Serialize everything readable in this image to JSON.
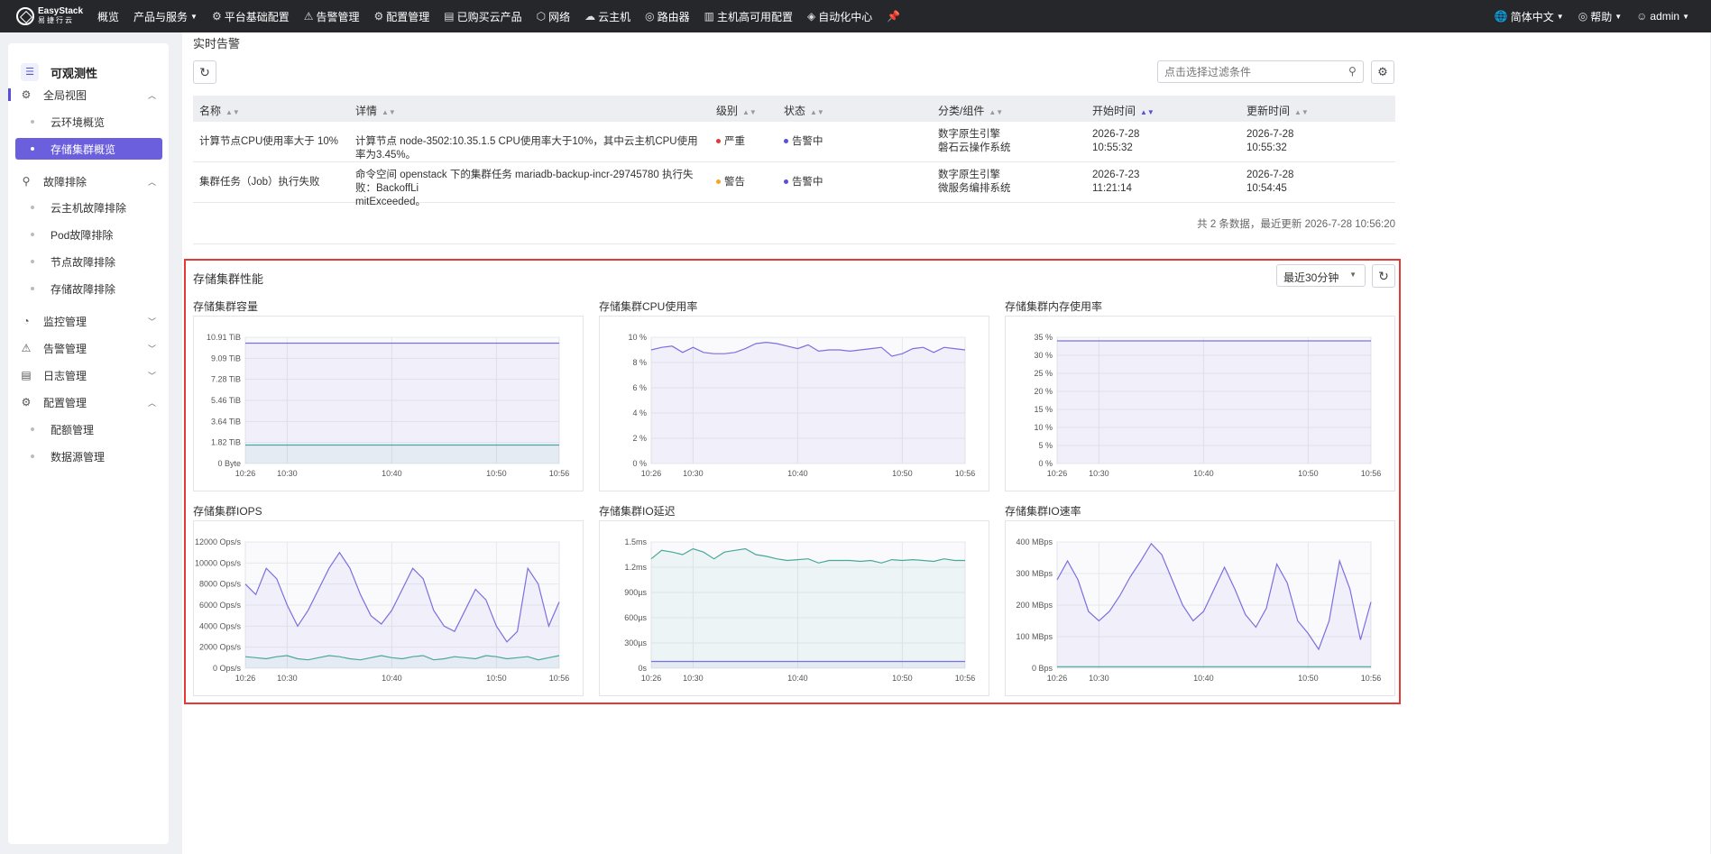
{
  "topbar": {
    "brand_line1": "EasyStack",
    "brand_line2": "易捷行云",
    "nav": [
      {
        "icon": "",
        "label": "概览",
        "caret": false
      },
      {
        "icon": "",
        "label": "产品与服务",
        "caret": true
      },
      {
        "icon": "⚙",
        "label": "平台基础配置",
        "caret": false
      },
      {
        "icon": "⚠",
        "label": "告警管理",
        "caret": false
      },
      {
        "icon": "⚙",
        "label": "配置管理",
        "caret": false
      },
      {
        "icon": "▤",
        "label": "已购买云产品",
        "caret": false
      },
      {
        "icon": "⬡",
        "label": "网络",
        "caret": false
      },
      {
        "icon": "☁",
        "label": "云主机",
        "caret": false
      },
      {
        "icon": "◎",
        "label": "路由器",
        "caret": false
      },
      {
        "icon": "▥",
        "label": "主机高可用配置",
        "caret": false
      },
      {
        "icon": "◈",
        "label": "自动化中心",
        "caret": false
      },
      {
        "icon": "📌",
        "label": "",
        "caret": false
      }
    ],
    "language": "简体中文",
    "help": "帮助",
    "user": "admin"
  },
  "sidebar": {
    "title": "可观测性",
    "groups": [
      {
        "label": "全局视图",
        "icon": "⚙",
        "expanded": true
      },
      {
        "label": "故障排除",
        "icon": "⚲",
        "expanded": true
      },
      {
        "label": "监控管理",
        "icon": "◔",
        "expanded": false
      },
      {
        "label": "告警管理",
        "icon": "⚠",
        "expanded": false
      },
      {
        "label": "日志管理",
        "icon": "▤",
        "expanded": false
      },
      {
        "label": "配置管理",
        "icon": "⚙",
        "expanded": true
      }
    ],
    "items": [
      {
        "label": "云环境概览"
      },
      {
        "label": "存储集群概览"
      },
      {
        "label": "云主机故障排除"
      },
      {
        "label": "Pod故障排除"
      },
      {
        "label": "节点故障排除"
      },
      {
        "label": "存储故障排除"
      },
      {
        "label": "配额管理"
      },
      {
        "label": "数据源管理"
      }
    ]
  },
  "alerts": {
    "title": "实时告警",
    "filter_placeholder": "点击选择过滤条件",
    "columns": [
      "名称",
      "详情",
      "级别",
      "状态",
      "分类/组件",
      "开始时间",
      "更新时间"
    ],
    "rows": [
      {
        "name": "计算节点CPU使用率大于 10%",
        "detail1": "计算节点 node-3502:10.35.1.5 CPU使用率大于10%，其中云主机CPU使用率为3.45%。",
        "detail2": "",
        "level": "严重",
        "level_color": "#e53935",
        "status": "告警中",
        "category1": "数字原生引擎",
        "category2": "磐石云操作系统",
        "start_date": "2026-7-28",
        "start_time": "10:55:32",
        "update_date": "2026-7-28",
        "update_time": "10:55:32"
      },
      {
        "name": "集群任务（Job）执行失败",
        "detail1": "命令空间 openstack 下的集群任务 mariadb-backup-incr-29745780 执行失败：BackoffLi",
        "detail2": "mitExceeded。",
        "level": "警告",
        "level_color": "#f5a623",
        "status": "告警中",
        "category1": "数字原生引擎",
        "category2": "微服务编排系统",
        "start_date": "2026-7-23",
        "start_time": "11:21:14",
        "update_date": "2026-7-28",
        "update_time": "10:54:45"
      }
    ],
    "footer": "共 2 条数据，最近更新  2026-7-28 10:56:20"
  },
  "perf": {
    "title": "存储集群性能",
    "range": "最近30分钟"
  },
  "chart_data": [
    {
      "type": "line",
      "title": "存储集群容量",
      "x_ticks": [
        "10:26",
        "10:30",
        "10:40",
        "10:50",
        "10:56"
      ],
      "y_ticks": [
        "0 Byte",
        "1.82 TiB",
        "3.64 TiB",
        "5.46 TiB",
        "7.28 TiB",
        "9.09 TiB",
        "10.91 TiB"
      ],
      "ylim": [
        0,
        10.91
      ],
      "series": [
        {
          "color": "#7b6fe0",
          "values": [
            10.4,
            10.4,
            10.4,
            10.4,
            10.4,
            10.4,
            10.4,
            10.4,
            10.4,
            10.4,
            10.4,
            10.4,
            10.4,
            10.4,
            10.4,
            10.4,
            10.4,
            10.4,
            10.4,
            10.4,
            10.4,
            10.4,
            10.4,
            10.4,
            10.4,
            10.4,
            10.4,
            10.4,
            10.4,
            10.4,
            10.4
          ]
        },
        {
          "color": "#4aa79b",
          "values": [
            1.6,
            1.6,
            1.6,
            1.6,
            1.6,
            1.6,
            1.6,
            1.6,
            1.6,
            1.6,
            1.6,
            1.6,
            1.6,
            1.6,
            1.6,
            1.6,
            1.6,
            1.6,
            1.6,
            1.6,
            1.6,
            1.6,
            1.6,
            1.6,
            1.6,
            1.6,
            1.6,
            1.6,
            1.6,
            1.6,
            1.6
          ]
        }
      ]
    },
    {
      "type": "line",
      "title": "存储集群CPU使用率",
      "x_ticks": [
        "10:26",
        "10:30",
        "10:40",
        "10:50",
        "10:56"
      ],
      "y_ticks": [
        "0 %",
        "2 %",
        "4 %",
        "6 %",
        "8 %",
        "10 %"
      ],
      "ylim": [
        0,
        10
      ],
      "series": [
        {
          "color": "#7b6fe0",
          "values": [
            9.0,
            9.2,
            9.3,
            8.8,
            9.2,
            8.8,
            8.7,
            8.7,
            8.8,
            9.1,
            9.5,
            9.6,
            9.5,
            9.3,
            9.1,
            9.4,
            8.9,
            9.0,
            9.0,
            8.9,
            9.0,
            9.1,
            9.2,
            8.5,
            8.7,
            9.1,
            9.2,
            8.8,
            9.2,
            9.1,
            9.0
          ]
        }
      ]
    },
    {
      "type": "line",
      "title": "存储集群内存使用率",
      "x_ticks": [
        "10:26",
        "10:30",
        "10:40",
        "10:50",
        "10:56"
      ],
      "y_ticks": [
        "0 %",
        "5 %",
        "10 %",
        "15 %",
        "20 %",
        "25 %",
        "30 %",
        "35 %"
      ],
      "ylim": [
        0,
        35
      ],
      "series": [
        {
          "color": "#7b6fe0",
          "values": [
            34.0,
            34.0,
            34.0,
            34.0,
            34.0,
            34.0,
            34.0,
            34.0,
            34.0,
            34.0,
            34.0,
            34.0,
            34.0,
            34.0,
            34.0,
            34.0,
            34.0,
            34.0,
            34.0,
            34.0,
            34.0,
            34.0,
            34.0,
            34.0,
            34.0,
            34.0,
            34.0,
            34.0,
            34.0,
            34.0,
            34.0
          ]
        }
      ]
    },
    {
      "type": "line",
      "title": "存储集群IOPS",
      "x_ticks": [
        "10:26",
        "10:30",
        "10:40",
        "10:50",
        "10:56"
      ],
      "y_ticks": [
        "0 Ops/s",
        "2000 Ops/s",
        "4000 Ops/s",
        "6000 Ops/s",
        "8000 Ops/s",
        "10000 Ops/s",
        "12000 Ops/s"
      ],
      "ylim": [
        0,
        12000
      ],
      "series": [
        {
          "color": "#7b6fe0",
          "values": [
            8000,
            7000,
            9500,
            8500,
            6000,
            4000,
            5500,
            7500,
            9500,
            11000,
            9500,
            7000,
            5000,
            4200,
            5500,
            7500,
            9500,
            8500,
            5500,
            4000,
            3500,
            5500,
            7500,
            6500,
            4000,
            2500,
            3500,
            9500,
            8000,
            4000,
            6300
          ]
        },
        {
          "color": "#4aa79b",
          "values": [
            1100,
            1000,
            900,
            1100,
            1200,
            900,
            800,
            1000,
            1200,
            1100,
            900,
            800,
            1000,
            1200,
            1000,
            900,
            1100,
            1200,
            800,
            900,
            1100,
            1000,
            900,
            1200,
            1100,
            900,
            1000,
            1100,
            800,
            1000,
            1200
          ]
        }
      ]
    },
    {
      "type": "line",
      "title": "存储集群IO延迟",
      "x_ticks": [
        "10:26",
        "10:30",
        "10:40",
        "10:50",
        "10:56"
      ],
      "y_ticks": [
        "0s",
        "300µs",
        "600µs",
        "900µs",
        "1.2ms",
        "1.5ms"
      ],
      "ylim": [
        0,
        1500
      ],
      "series": [
        {
          "color": "#4aa79b",
          "values": [
            1300,
            1400,
            1380,
            1350,
            1420,
            1380,
            1300,
            1380,
            1400,
            1420,
            1350,
            1330,
            1300,
            1280,
            1290,
            1300,
            1250,
            1280,
            1280,
            1280,
            1270,
            1280,
            1250,
            1290,
            1280,
            1290,
            1280,
            1270,
            1300,
            1280,
            1280
          ]
        },
        {
          "color": "#7b6fe0",
          "values": [
            80,
            80,
            80,
            80,
            80,
            80,
            80,
            80,
            80,
            80,
            80,
            80,
            80,
            80,
            80,
            80,
            80,
            80,
            80,
            80,
            80,
            80,
            80,
            80,
            80,
            80,
            80,
            80,
            80,
            80,
            80
          ]
        }
      ]
    },
    {
      "type": "line",
      "title": "存储集群IO速率",
      "x_ticks": [
        "10:26",
        "10:30",
        "10:40",
        "10:50",
        "10:56"
      ],
      "y_ticks": [
        "0 Bps",
        "100 MBps",
        "200 MBps",
        "300 MBps",
        "400 MBps"
      ],
      "ylim": [
        0,
        400
      ],
      "series": [
        {
          "color": "#7b6fe0",
          "values": [
            280,
            340,
            280,
            180,
            150,
            180,
            230,
            290,
            340,
            395,
            360,
            280,
            200,
            150,
            180,
            250,
            320,
            250,
            170,
            130,
            190,
            330,
            270,
            150,
            110,
            60,
            150,
            340,
            250,
            90,
            210
          ]
        },
        {
          "color": "#4aa79b",
          "values": [
            5,
            5,
            5,
            5,
            5,
            5,
            5,
            5,
            5,
            5,
            5,
            5,
            5,
            5,
            5,
            5,
            5,
            5,
            5,
            5,
            5,
            5,
            5,
            5,
            5,
            5,
            5,
            5,
            5,
            5,
            5
          ]
        }
      ]
    }
  ]
}
